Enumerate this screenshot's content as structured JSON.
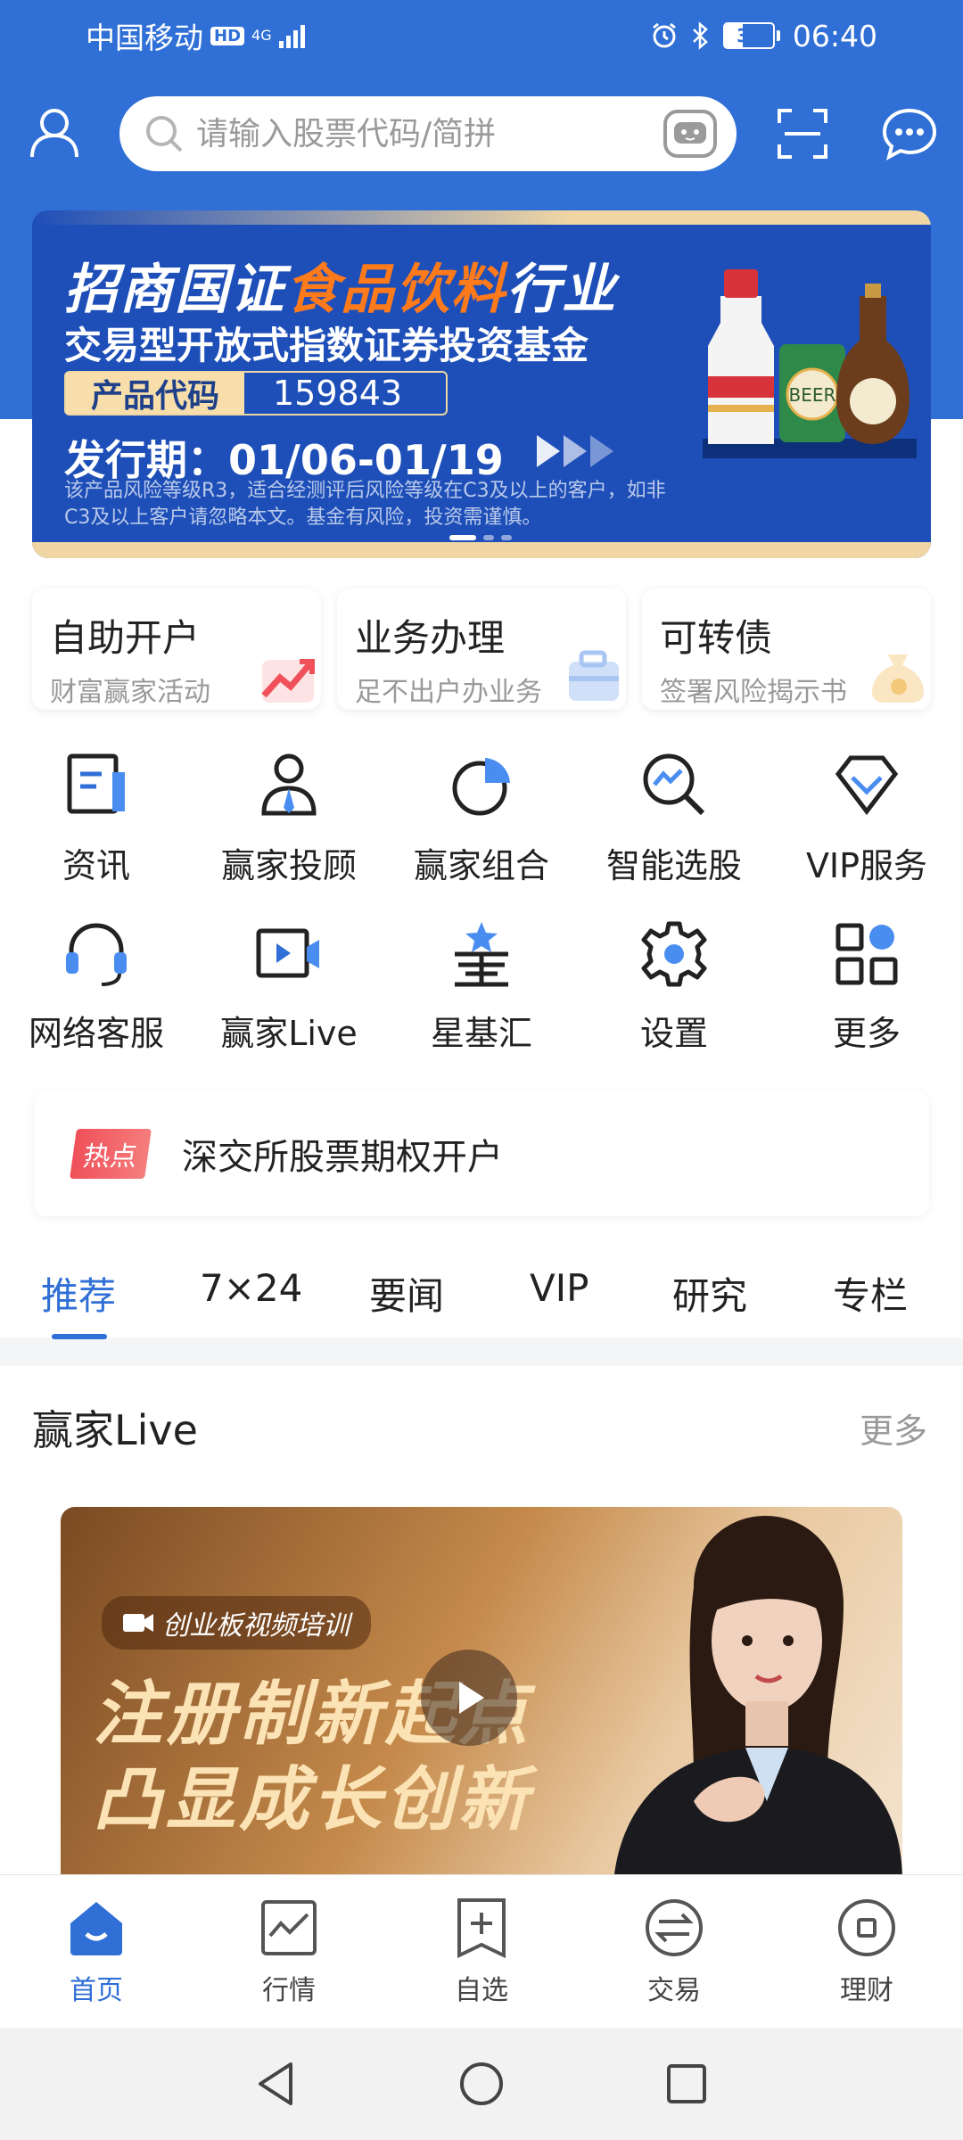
{
  "status_bar": {
    "carrier": "中国移动",
    "hd": "HD",
    "network": "4G",
    "battery": "37",
    "battery_level": 0.37,
    "time": "06:40"
  },
  "search": {
    "placeholder": "请输入股票代码/简拼"
  },
  "banner": {
    "title_prefix": "招商国证",
    "title_highlight": "食品饮料",
    "title_suffix": "行业",
    "subtitle": "交易型开放式指数证券投资基金",
    "code_label": "产品代码",
    "code_value": "159843",
    "issue_date": "发行期：01/06-01/19",
    "disclaimer": "该产品风险等级R3，适合经测评后风险等级在C3及以上的客户，如非C3及以上客户请忽略本文。基金有风险，投资需谨慎。",
    "product_label": "BEER"
  },
  "quick_cards": [
    {
      "title": "自助开户",
      "subtitle": "财富赢家活动"
    },
    {
      "title": "业务办理",
      "subtitle": "足不出户办业务"
    },
    {
      "title": "可转债",
      "subtitle": "签署风险揭示书"
    }
  ],
  "grid": [
    {
      "label": "资讯",
      "icon": "news-icon"
    },
    {
      "label": "赢家投顾",
      "icon": "advisor-icon"
    },
    {
      "label": "赢家组合",
      "icon": "portfolio-icon"
    },
    {
      "label": "智能选股",
      "icon": "stock-picker-icon"
    },
    {
      "label": "VIP服务",
      "icon": "vip-icon"
    },
    {
      "label": "网络客服",
      "icon": "headset-icon"
    },
    {
      "label": "赢家Live",
      "icon": "live-video-icon"
    },
    {
      "label": "星基汇",
      "icon": "star-fund-icon"
    },
    {
      "label": "设置",
      "icon": "settings-gear-icon"
    },
    {
      "label": "更多",
      "icon": "more-apps-icon"
    }
  ],
  "hot": {
    "badge": "热点",
    "text": "深交所股票期权开户"
  },
  "tabs": [
    {
      "label": "推荐",
      "active": true
    },
    {
      "label": "7×24",
      "active": false
    },
    {
      "label": "要闻",
      "active": false
    },
    {
      "label": "VIP",
      "active": false
    },
    {
      "label": "研究",
      "active": false
    },
    {
      "label": "专栏",
      "active": false
    }
  ],
  "live": {
    "title": "赢家Live",
    "more": "更多",
    "tag": "创业板视频培训",
    "line1": "注册制新起点",
    "line2": "凸显成长创新"
  },
  "bottom_nav": [
    {
      "label": "首页",
      "icon": "home-icon",
      "active": true
    },
    {
      "label": "行情",
      "icon": "market-chart-icon",
      "active": false
    },
    {
      "label": "自选",
      "icon": "watchlist-add-icon",
      "active": false
    },
    {
      "label": "交易",
      "icon": "trade-exchange-icon",
      "active": false
    },
    {
      "label": "理财",
      "icon": "wealth-icon",
      "active": false
    }
  ],
  "colors": {
    "brand_blue": "#2f6fd6",
    "accent_orange": "#ff7a1a",
    "hot_red": "#f0505a"
  }
}
